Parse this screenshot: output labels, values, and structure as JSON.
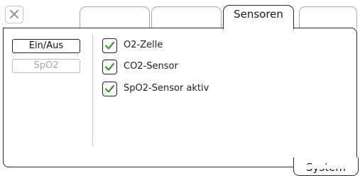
{
  "tabs": [
    {
      "label": "",
      "active": false
    },
    {
      "label": "",
      "active": false
    },
    {
      "label": "Sensoren",
      "active": true
    },
    {
      "label": "",
      "active": false
    }
  ],
  "sidebar": {
    "buttons": [
      {
        "label": "Ein/Aus",
        "enabled": true
      },
      {
        "label": "SpO2",
        "enabled": false
      }
    ]
  },
  "sensors": [
    {
      "label": "O2-Zelle",
      "checked": true
    },
    {
      "label": "CO2-Sensor",
      "checked": true
    },
    {
      "label": "SpO2-Sensor aktiv",
      "checked": true
    }
  ],
  "bottom_tab": {
    "label": "System"
  },
  "icons": {
    "close": "close-icon",
    "check": "checkmark-icon"
  },
  "colors": {
    "check": "#3a9a2a",
    "border_active": "#2a2a2a",
    "border_inactive": "#aaaaaa",
    "disabled_text": "#a9a9a9"
  }
}
